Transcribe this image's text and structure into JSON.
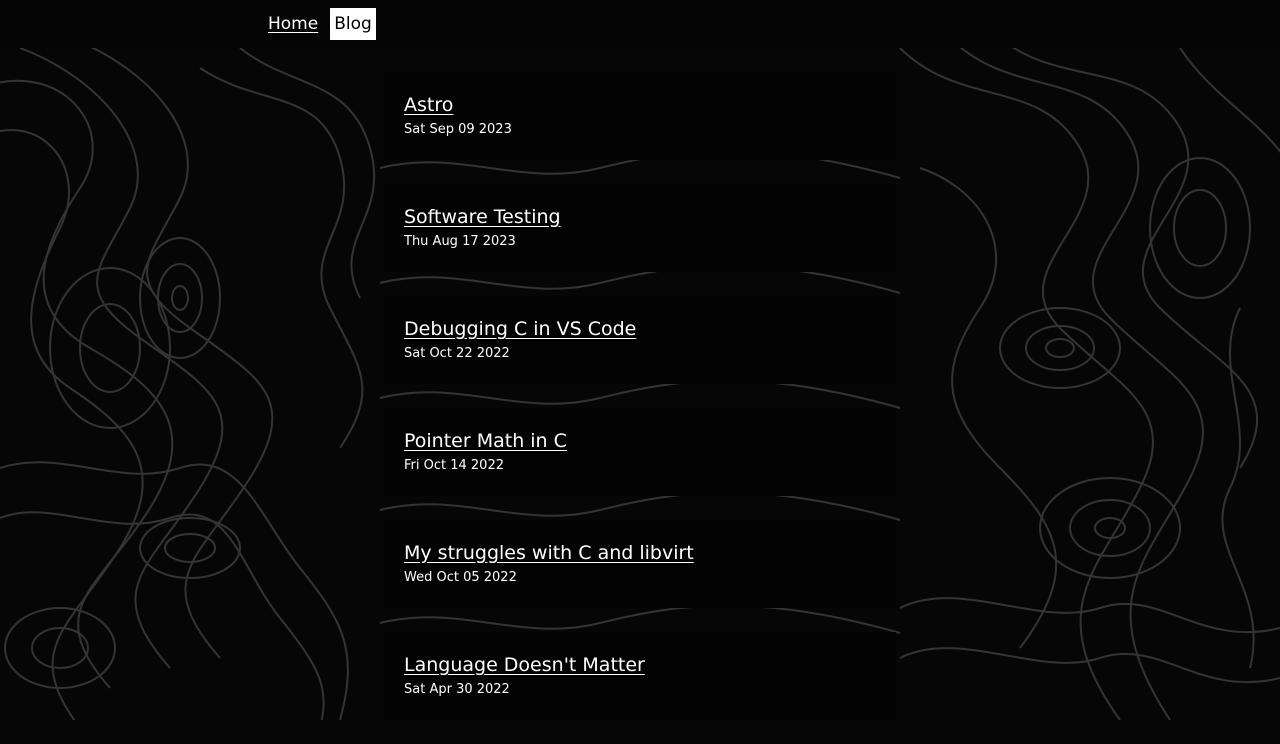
{
  "nav": {
    "home": "Home",
    "blog": "Blog"
  },
  "posts": [
    {
      "title": "Astro",
      "date": "Sat Sep 09 2023"
    },
    {
      "title": "Software Testing",
      "date": "Thu Aug 17 2023"
    },
    {
      "title": "Debugging C in VS Code",
      "date": "Sat Oct 22 2022"
    },
    {
      "title": "Pointer Math in C",
      "date": "Fri Oct 14 2022"
    },
    {
      "title": "My struggles with C and libvirt",
      "date": "Wed Oct 05 2022"
    },
    {
      "title": "Language Doesn't Matter",
      "date": "Sat Apr 30 2022"
    }
  ],
  "colors": {
    "background": "#060606",
    "contour_line": "#3a3a3a",
    "card": "#030303",
    "text": "#ffffff",
    "active_nav_bg": "#ffffff"
  }
}
